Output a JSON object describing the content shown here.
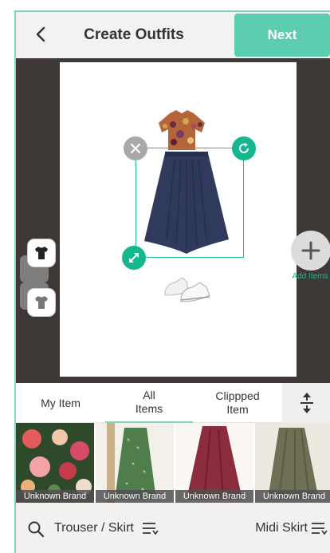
{
  "header": {
    "title": "Create Outfits",
    "next_label": "Next"
  },
  "canvas": {
    "add_label": "Add Items"
  },
  "tabs": [
    {
      "label": "My Item"
    },
    {
      "label": "All Items",
      "active": true
    },
    {
      "label": "Clippped Item"
    }
  ],
  "items": [
    {
      "brand": "Unknown Brand",
      "image": "floral-top-icon"
    },
    {
      "brand": "Unknown Brand",
      "image": "green-skirt-icon"
    },
    {
      "brand": "Unknown Brand",
      "image": "burgundy-skirt-icon"
    },
    {
      "brand": "Unknown Brand",
      "image": "olive-skirt-icon"
    }
  ],
  "filter": {
    "category": "Trouser / Skirt",
    "subcategory": "Midi Skirt"
  },
  "colors": {
    "accent": "#5dcdb0",
    "canvas_bg": "#3e3936",
    "selection": "#19b891"
  }
}
